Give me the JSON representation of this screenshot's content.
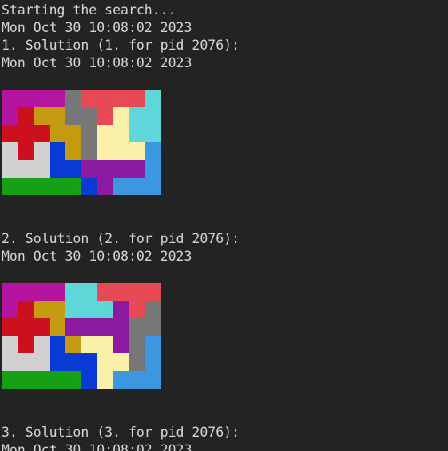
{
  "lines": {
    "start": "Starting the search...",
    "date0": "Mon Oct 30 10:08:02 2023",
    "sol1": "1. Solution (1. for pid 2076):",
    "date1": "Mon Oct 30 10:08:02 2023",
    "sol2": "2. Solution (2. for pid 2076):",
    "date2": "Mon Oct 30 10:08:02 2023",
    "sol3": "3. Solution (3. for pid 2076):",
    "date3": "Mon Oct 30 10:08:02 2023"
  },
  "palette": {
    "M": "#b5149f",
    "X": "#cc1020",
    "G": "#777777",
    "R": "#e84a55",
    "C": "#5fd6d8",
    "O": "#c49a10",
    "Y": "#fbf0a8",
    "W": "#d0d0d0",
    "B": "#0a3ad4",
    "P": "#8b1a9e",
    "L": "#3d97e0",
    "N": "#16a016"
  },
  "solutions": [
    [
      "MMMMGRRRRC",
      "MXOOGGRYCC",
      "XXXOOGYYCC",
      "WXWBOGYYYL",
      "WWWBBPPPPL",
      "NNNNNBPLLL"
    ],
    [
      "MMMMCCRRRR",
      "MXOOCCCPRG",
      "XXXOPPPPGG",
      "WXWBOYYPGL",
      "WWWBBBYYGL",
      "NNNNNBYLLL"
    ]
  ]
}
